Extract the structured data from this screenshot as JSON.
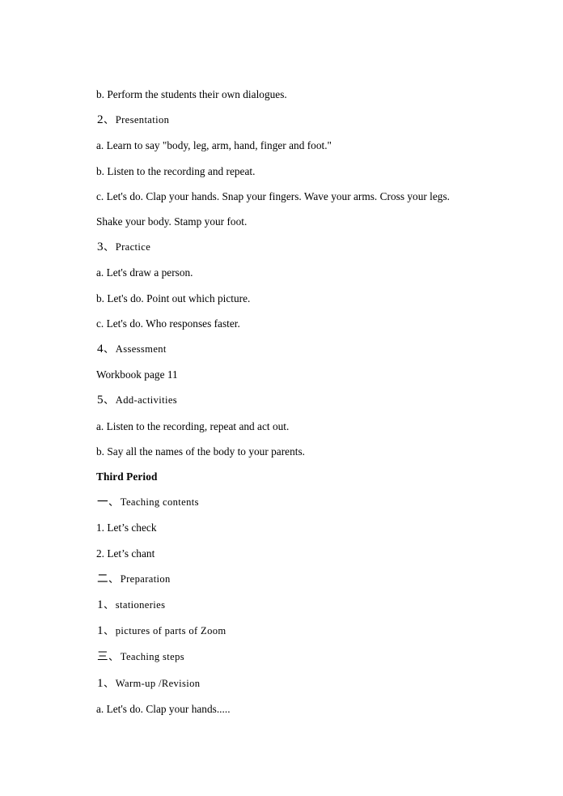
{
  "document": {
    "page_background": "#ffffff",
    "text_color": "#000000",
    "lines": [
      {
        "id": "line-perform-dialogues",
        "kind": "plain",
        "text": "b. Perform the students their own dialogues."
      },
      {
        "id": "line-section-2-presentation",
        "kind": "enum",
        "numeral": "2",
        "separator": "、",
        "text": "Presentation"
      },
      {
        "id": "line-learn-to-say",
        "kind": "plain",
        "text": "a. Learn to say \"body, leg, arm, hand, finger and foot.\""
      },
      {
        "id": "line-listen-repeat",
        "kind": "plain",
        "text": "b. Listen to the recording and repeat."
      },
      {
        "id": "line-lets-do-clap",
        "kind": "plain",
        "text": "c. Let's do. Clap your hands. Snap your fingers. Wave your arms. Cross your legs."
      },
      {
        "id": "line-shake-stamp",
        "kind": "plain",
        "text": "Shake your body. Stamp your foot."
      },
      {
        "id": "line-section-3-practice",
        "kind": "enum",
        "numeral": "3",
        "separator": "、",
        "text": "Practice"
      },
      {
        "id": "line-draw-a-person",
        "kind": "plain",
        "text": "a. Let's draw a person."
      },
      {
        "id": "line-point-out-picture",
        "kind": "plain",
        "text": "b. Let's do. Point out which picture."
      },
      {
        "id": "line-who-responses-faster",
        "kind": "plain",
        "text": "c. Let's do. Who responses faster."
      },
      {
        "id": "line-section-4-assessment",
        "kind": "enum",
        "numeral": "4",
        "separator": "、",
        "text": "Assessment"
      },
      {
        "id": "line-workbook-page",
        "kind": "plain",
        "text": "Workbook page 11"
      },
      {
        "id": "line-section-5-add-activities",
        "kind": "enum",
        "numeral": "5",
        "separator": "、",
        "text": "Add-activities"
      },
      {
        "id": "line-listen-repeat-act-out",
        "kind": "plain",
        "text": "a. Listen to the recording, repeat and act out."
      },
      {
        "id": "line-say-names-to-parents",
        "kind": "plain",
        "text": "b. Say all the names of the body to your parents."
      },
      {
        "id": "line-heading-third-period",
        "kind": "bold",
        "text": "Third Period"
      },
      {
        "id": "line-section-yi-teaching-contents",
        "kind": "cjk-enum",
        "numeral": "一",
        "separator": "、",
        "text": "Teaching contents"
      },
      {
        "id": "line-lets-check",
        "kind": "plain",
        "text": "1. Let’s check"
      },
      {
        "id": "line-lets-chant",
        "kind": "plain",
        "text": "2. Let’s chant"
      },
      {
        "id": "line-section-er-preparation",
        "kind": "cjk-enum",
        "numeral": "二",
        "separator": "、",
        "text": "Preparation"
      },
      {
        "id": "line-item-stationeries",
        "kind": "enum",
        "numeral": "1",
        "separator": "、",
        "text": "stationeries"
      },
      {
        "id": "line-item-pictures-zoom",
        "kind": "enum",
        "numeral": "1",
        "separator": "、",
        "text": "pictures of parts of Zoom"
      },
      {
        "id": "line-section-san-teaching-steps",
        "kind": "cjk-enum",
        "numeral": "三",
        "separator": "、",
        "text": "Teaching steps"
      },
      {
        "id": "line-step-1-warm-up",
        "kind": "enum",
        "numeral": "1",
        "separator": "、",
        "text": "Warm-up /Revision"
      },
      {
        "id": "line-lets-do-clap-hands-ellipsis",
        "kind": "plain",
        "text": "a. Let's do. Clap your hands....."
      }
    ]
  }
}
